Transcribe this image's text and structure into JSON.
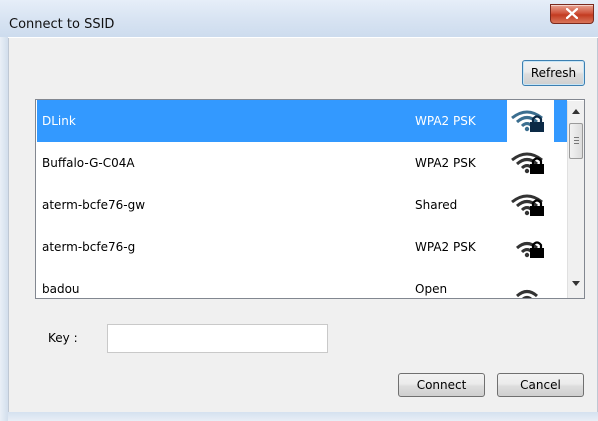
{
  "window": {
    "title": "Connect to SSID"
  },
  "toolbar": {
    "refresh_label": "Refresh"
  },
  "networks": [
    {
      "ssid": "DLink",
      "security": "WPA2 PSK",
      "icon": "wifi-locked-icon",
      "selected": true,
      "signal_bars": 3
    },
    {
      "ssid": "Buffalo-G-C04A",
      "security": "WPA2 PSK",
      "icon": "wifi-locked-icon",
      "selected": false,
      "signal_bars": 3
    },
    {
      "ssid": "aterm-bcfe76-gw",
      "security": "Shared",
      "icon": "wifi-locked-icon",
      "selected": false,
      "signal_bars": 3
    },
    {
      "ssid": "aterm-bcfe76-g",
      "security": "WPA2 PSK",
      "icon": "wifi-locked-icon",
      "selected": false,
      "signal_bars": 2
    },
    {
      "ssid": "badou",
      "security": "Open",
      "icon": "wifi-icon",
      "selected": false,
      "signal_bars": 2
    }
  ],
  "key": {
    "label": "Key :",
    "value": "",
    "placeholder": ""
  },
  "buttons": {
    "connect_label": "Connect",
    "cancel_label": "Cancel"
  },
  "colors": {
    "selection": "#3399ff",
    "close_button": "#c9472e"
  }
}
